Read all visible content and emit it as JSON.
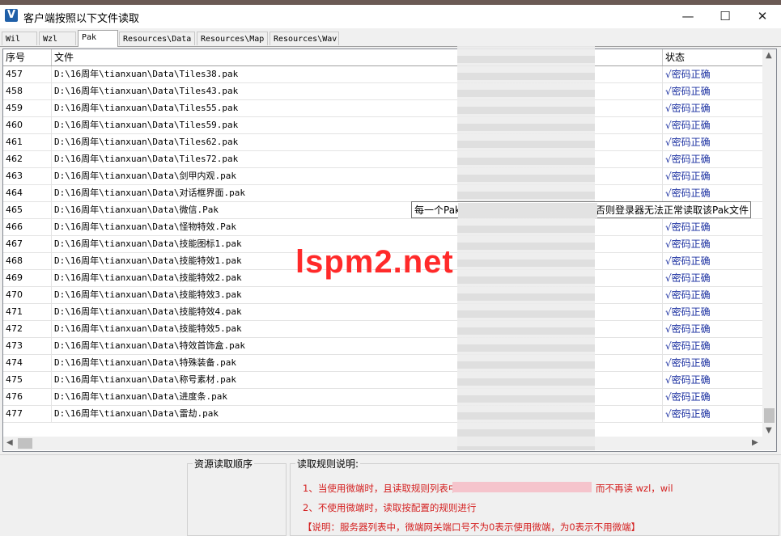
{
  "window": {
    "title": "客户端按照以下文件读取",
    "icon": "V",
    "min_glyph": "—",
    "max_glyph": "☐",
    "close_glyph": "✕"
  },
  "tabs": [
    "Wil",
    "Wzl",
    "Pak",
    "Resources\\Data",
    "Resources\\Map",
    "Resources\\Wav"
  ],
  "active_tab": "Pak",
  "table": {
    "columns": [
      "序号",
      "文件",
      "状态"
    ],
    "rows": [
      {
        "seq": "457",
        "file": "D:\\16周年\\tianxuan\\Data\\Tiles38.pak",
        "status": "√密码正确"
      },
      {
        "seq": "458",
        "file": "D:\\16周年\\tianxuan\\Data\\Tiles43.pak",
        "status": "√密码正确"
      },
      {
        "seq": "459",
        "file": "D:\\16周年\\tianxuan\\Data\\Tiles55.pak",
        "status": "√密码正确"
      },
      {
        "seq": "460",
        "file": "D:\\16周年\\tianxuan\\Data\\Tiles59.pak",
        "status": "√密码正确"
      },
      {
        "seq": "461",
        "file": "D:\\16周年\\tianxuan\\Data\\Tiles62.pak",
        "status": "√密码正确"
      },
      {
        "seq": "462",
        "file": "D:\\16周年\\tianxuan\\Data\\Tiles72.pak",
        "status": "√密码正确"
      },
      {
        "seq": "463",
        "file": "D:\\16周年\\tianxuan\\Data\\剑甲内观.pak",
        "status": "√密码正确"
      },
      {
        "seq": "464",
        "file": "D:\\16周年\\tianxuan\\Data\\对话框界面.pak",
        "status": "√密码正确"
      },
      {
        "seq": "465",
        "file": "D:\\16周年\\tianxuan\\Data\\微信.Pak",
        "status": ""
      },
      {
        "seq": "466",
        "file": "D:\\16周年\\tianxuan\\Data\\怪物特效.Pak",
        "status": "√密码正确"
      },
      {
        "seq": "467",
        "file": "D:\\16周年\\tianxuan\\Data\\技能图标1.pak",
        "status": "√密码正确"
      },
      {
        "seq": "468",
        "file": "D:\\16周年\\tianxuan\\Data\\技能特效1.pak",
        "status": "√密码正确"
      },
      {
        "seq": "469",
        "file": "D:\\16周年\\tianxuan\\Data\\技能特效2.pak",
        "status": "√密码正确"
      },
      {
        "seq": "470",
        "file": "D:\\16周年\\tianxuan\\Data\\技能特效3.pak",
        "status": "√密码正确"
      },
      {
        "seq": "471",
        "file": "D:\\16周年\\tianxuan\\Data\\技能特效4.pak",
        "status": "√密码正确"
      },
      {
        "seq": "472",
        "file": "D:\\16周年\\tianxuan\\Data\\技能特效5.pak",
        "status": "√密码正确"
      },
      {
        "seq": "473",
        "file": "D:\\16周年\\tianxuan\\Data\\特效首饰盒.pak",
        "status": "√密码正确"
      },
      {
        "seq": "474",
        "file": "D:\\16周年\\tianxuan\\Data\\特殊装备.pak",
        "status": "√密码正确"
      },
      {
        "seq": "475",
        "file": "D:\\16周年\\tianxuan\\Data\\称号素材.pak",
        "status": "√密码正确"
      },
      {
        "seq": "476",
        "file": "D:\\16周年\\tianxuan\\Data\\进度条.pak",
        "status": "√密码正确"
      },
      {
        "seq": "477",
        "file": "D:\\16周年\\tianxuan\\Data\\雷劫.pak",
        "status": "√密码正确"
      }
    ]
  },
  "tooltip": {
    "start": "每一个Pak",
    "end": "否则登录器无法正常读取该Pak文件"
  },
  "watermark": "lspm2.net",
  "bottom": {
    "order_label": "资源读取顺序",
    "rules_label": "读取规则说明:",
    "rule1": "1、当使用微端时，且读取规则列表中",
    "rule1_tail": "而不再读 wzl，wil",
    "rule2": "2、不使用微端时，读取按配置的规则进行",
    "rule3": "【说明：服务器列表中，微端网关端口号不为0表示使用微端，为0表示不用微端】"
  },
  "colors": {
    "status_text": "#1a2fa0",
    "rule_text": "#d42020",
    "watermark": "#ff2a2a"
  }
}
